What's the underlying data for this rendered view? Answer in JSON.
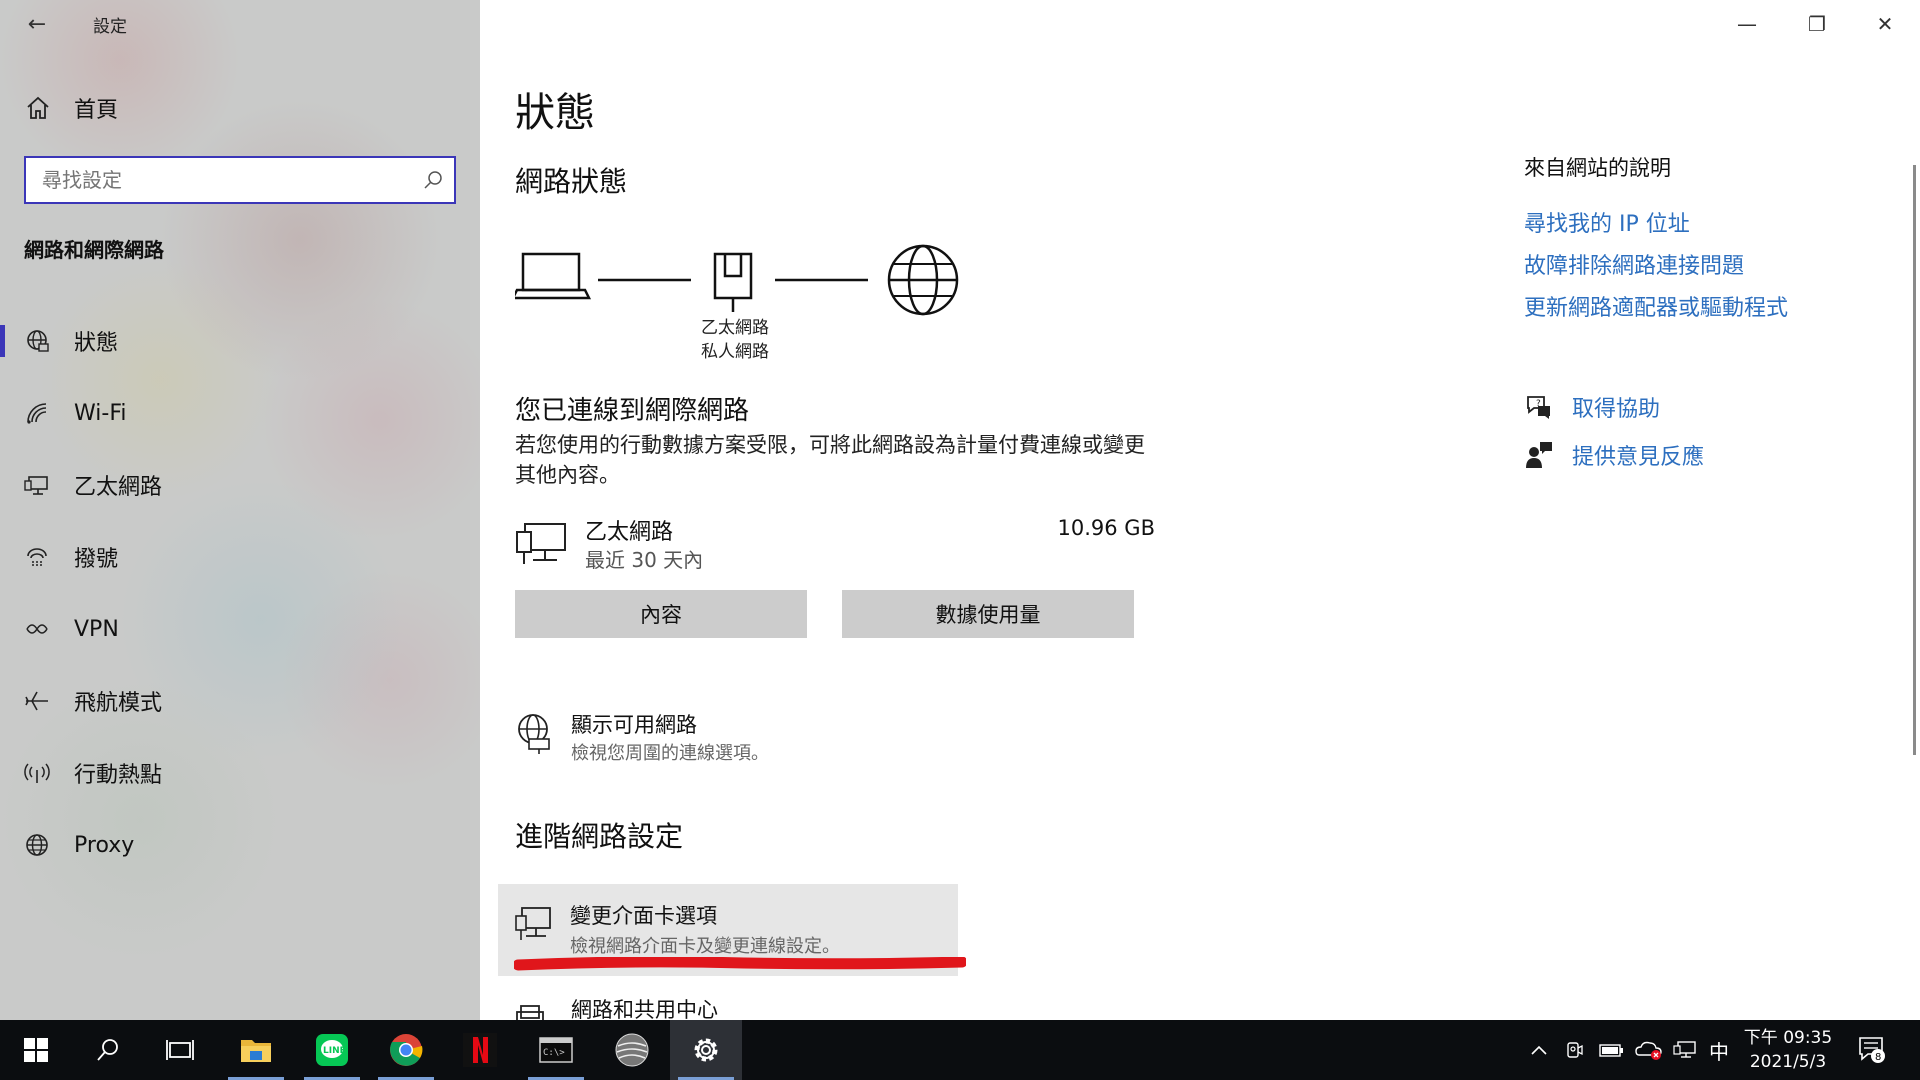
{
  "window": {
    "title": "設定",
    "controls": {
      "minimize": "—",
      "maximize": "❐",
      "close": "✕"
    }
  },
  "sidebar": {
    "home_label": "首頁",
    "search_placeholder": "尋找設定",
    "section_title": "網路和網際網路",
    "items": [
      {
        "label": "狀態",
        "icon": "globe-status-icon",
        "active": true
      },
      {
        "label": "Wi-Fi",
        "icon": "wifi-icon",
        "active": false
      },
      {
        "label": "乙太網路",
        "icon": "ethernet-icon",
        "active": false
      },
      {
        "label": "撥號",
        "icon": "dialup-icon",
        "active": false
      },
      {
        "label": "VPN",
        "icon": "vpn-icon",
        "active": false
      },
      {
        "label": "飛航模式",
        "icon": "airplane-icon",
        "active": false
      },
      {
        "label": "行動熱點",
        "icon": "hotspot-icon",
        "active": false
      },
      {
        "label": "Proxy",
        "icon": "proxy-globe-icon",
        "active": false
      }
    ]
  },
  "main": {
    "page_title": "狀態",
    "network_status_title": "網路狀態",
    "diagram": {
      "line1": "乙太網路",
      "line2": "私人網路"
    },
    "connected_title": "您已連線到網際網路",
    "connected_desc": "若您使用的行動數據方案受限，可將此網路設為計量付費連線或變更其他內容。",
    "ethernet": {
      "name": "乙太網路",
      "period": "最近 30 天內",
      "amount": "10.96 GB"
    },
    "buttons": {
      "properties": "內容",
      "data_usage": "數據使用量"
    },
    "available": {
      "title": "顯示可用網路",
      "subtitle": "檢視您周圍的連線選項。"
    },
    "advanced_title": "進階網路設定",
    "adapter": {
      "title": "變更介面卡選項",
      "subtitle": "檢視網路介面卡及變更連線設定。"
    },
    "sharing": {
      "title": "網路和共用中心"
    }
  },
  "right_panel": {
    "web_help_title": "來自網站的說明",
    "links": [
      "尋找我的 IP 位址",
      "故障排除網路連接問題",
      "更新網路適配器或驅動程式"
    ],
    "get_help": "取得協助",
    "feedback": "提供意見反應"
  },
  "taskbar": {
    "apps": [
      "start-icon",
      "search-icon",
      "task-view-icon",
      "file-explorer-icon",
      "line-icon",
      "chrome-icon",
      "netflix-icon",
      "terminal-icon",
      "globe-app-icon",
      "settings-gear-icon"
    ],
    "ime": "中",
    "time": "下午 09:35",
    "date": "2021/5/3",
    "notification_count": "8"
  },
  "colors": {
    "accent": "#3b36b8",
    "link": "#2d6fbf",
    "annotation": "#e0161b",
    "taskbar": "#0b0d10"
  }
}
